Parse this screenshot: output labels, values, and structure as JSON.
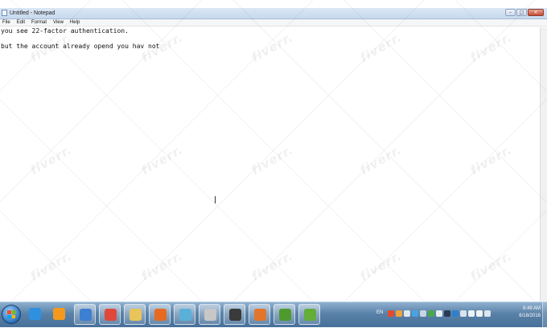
{
  "window": {
    "title": "Untitled - Notepad",
    "controls": {
      "minimize": "–",
      "maximize": "□",
      "close": "×"
    }
  },
  "menu": [
    "File",
    "Edit",
    "Format",
    "View",
    "Help"
  ],
  "editor": {
    "lines": [
      "you see 22-factor authentication.",
      "",
      "but the account already opend you hav not"
    ]
  },
  "watermark": {
    "text": "fiverr."
  },
  "taskbar": {
    "start_icon": "windows-logo-icon",
    "apps": [
      {
        "name": "internet-explorer",
        "icon": "ie-icon",
        "color": "#2f8fe0"
      },
      {
        "name": "media-player",
        "icon": "media-player-icon",
        "color": "#f39a1e"
      },
      {
        "name": "utility",
        "icon": "tools-icon",
        "color": "#3d7fd1"
      },
      {
        "name": "chrome",
        "icon": "chrome-icon",
        "color": "#e0483b"
      },
      {
        "name": "explorer",
        "icon": "folder-icon",
        "color": "#e8c45a"
      },
      {
        "name": "firefox",
        "icon": "firefox-icon",
        "color": "#e66a1f"
      },
      {
        "name": "app-blue",
        "icon": "app-icon",
        "color": "#5ab0d8"
      },
      {
        "name": "opera",
        "icon": "opera-icon",
        "color": "#c7c7c7"
      },
      {
        "name": "terminal",
        "icon": "terminal-icon",
        "color": "#3a3a3a"
      },
      {
        "name": "flash",
        "icon": "flash-icon",
        "color": "#e2752b"
      },
      {
        "name": "camtasia",
        "icon": "camtasia-icon",
        "color": "#4f9a2e"
      },
      {
        "name": "camtasia-recorder",
        "icon": "camtasia-icon",
        "color": "#63ad39"
      }
    ],
    "tray": {
      "language": "EN",
      "clock_time": "8:49 AM",
      "clock_date": "6/18/2016"
    }
  }
}
